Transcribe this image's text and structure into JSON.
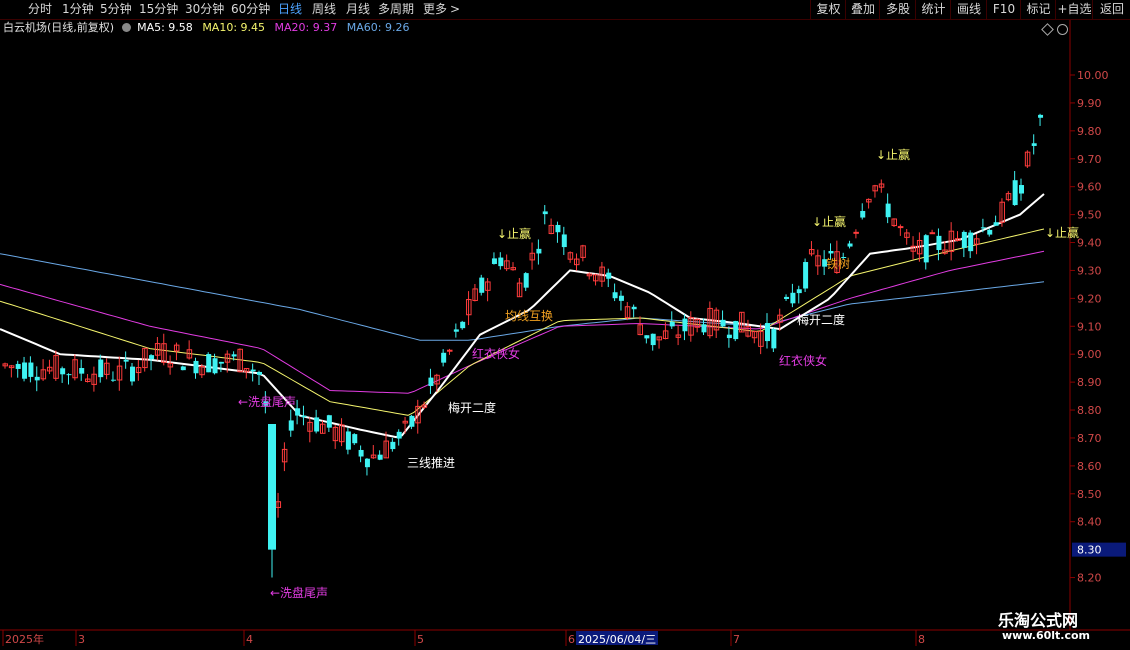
{
  "toolbar": {
    "periods": [
      "分时",
      "1分钟",
      "5分钟",
      "15分钟",
      "30分钟",
      "60分钟",
      "日线",
      "周线",
      "月线",
      "多周期",
      "更多"
    ],
    "active": "日线",
    "more_arrow": ">",
    "right_buttons": [
      "复权",
      "叠加",
      "多股",
      "统计",
      "画线",
      "F10",
      "标记",
      "+自选",
      "返回"
    ]
  },
  "info": {
    "title": "白云机场(日线,前复权)",
    "ma5": "MA5: 9.58",
    "ma10": "MA10: 9.45",
    "ma20": "MA20: 9.37",
    "ma60": "MA60: 9.26"
  },
  "colors": {
    "up": "#ff3c3c",
    "down": "#3ff2f2",
    "ma5": "#ffffff",
    "ma10": "#f5f56e",
    "ma20": "#e23ce2",
    "ma60": "#6aa8e6",
    "axis_red": "#8a0000"
  },
  "price_axis": {
    "ticks": [
      "10.00",
      "9.90",
      "9.80",
      "9.70",
      "9.60",
      "9.50",
      "9.40",
      "9.30",
      "9.20",
      "9.10",
      "9.00",
      "8.90",
      "8.80",
      "8.70",
      "8.60",
      "8.50",
      "8.40",
      "8.20"
    ],
    "current": "8.30"
  },
  "date_axis": {
    "labels": [
      "2025年",
      "3",
      "4",
      "5",
      "6",
      "7",
      "8"
    ],
    "highlight": "2025/06/04/三"
  },
  "annotations": {
    "wash_tail": "←洗盘尾声",
    "three_lines": "三线推进",
    "plum_twice": "梅开二度",
    "red_hero": "红衣侠女",
    "ma_swap": "均线互换",
    "take_profit": "↓止赢",
    "flower_tree": "铁树"
  },
  "watermark": {
    "name": "乐淘公式网",
    "url": "www.60lt.com"
  }
}
